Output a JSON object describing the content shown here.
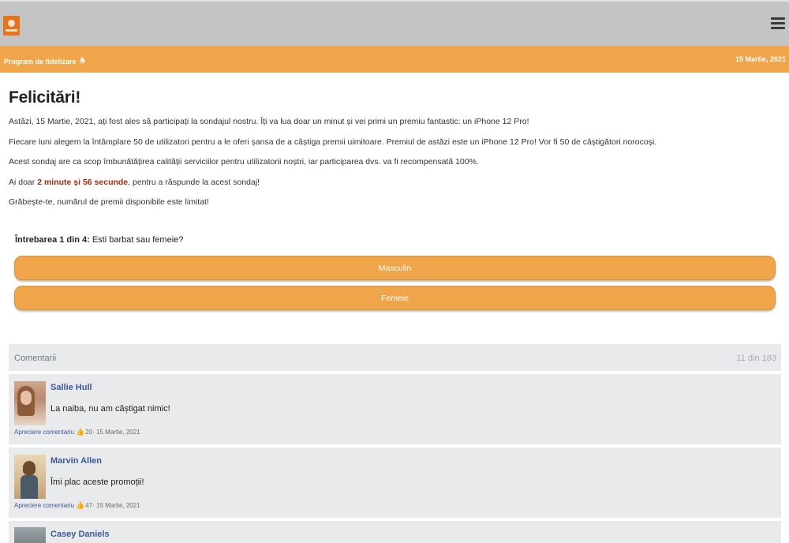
{
  "header": {
    "program_label": "Program de fidelizare",
    "bell_icon": "bell-icon",
    "date": "15 Martie, 2021",
    "menu_icon": "hamburger-menu-icon",
    "colors": {
      "topbar": "#c4c4c4",
      "accent": "#f0a54a"
    }
  },
  "main": {
    "title": "Felicitări!",
    "p1": "Astăzi, 15 Martie, 2021, ați fost ales să participați la sondajul nostru. Îți va lua doar un minut și vei primi un premiu fantastic: un iPhone 12 Pro!",
    "p2": "Fiecare luni alegem la întâmplare 50 de utilizatori pentru a le oferi șansa de a câștiga premii uimitoare. Premiul de astăzi este un iPhone 12 Pro! Vor fi 50 de câștigători norocoși.",
    "p3": "Acest sondaj are ca scop îmbunătățirea calității serviciilor pentru utilizatorii noștri, iar participarea dvs. va fi recompensată 100%.",
    "p4_prefix": "Ai doar ",
    "p4_timer": "2 minute și 56 secunde",
    "p4_suffix": ", pentru a răspunde la acest sondaj!",
    "p5": "Grăbește-te, numărul de premii disponibile este limitat!"
  },
  "survey": {
    "question_label": "Întrebarea 1 din 4:",
    "question_text": " Esti barbat sau femeie?",
    "answers": [
      "Masculin",
      "Femeie"
    ]
  },
  "comments": {
    "title": "Comentarii",
    "count": "11 din 183",
    "items": [
      {
        "name": "Sallie Hull",
        "text": "La naiba, nu am câștigat nimic!",
        "like_label": "Apreciere comentariu",
        "likes": "20",
        "date": " · 15 Martie, 2021"
      },
      {
        "name": "Marvin Allen",
        "text": "Îmi plac aceste promoții!",
        "like_label": "Apreciere comentariu",
        "likes": "47",
        "date": " · 15 Martie, 2021"
      },
      {
        "name": "Casey Daniels"
      }
    ]
  }
}
